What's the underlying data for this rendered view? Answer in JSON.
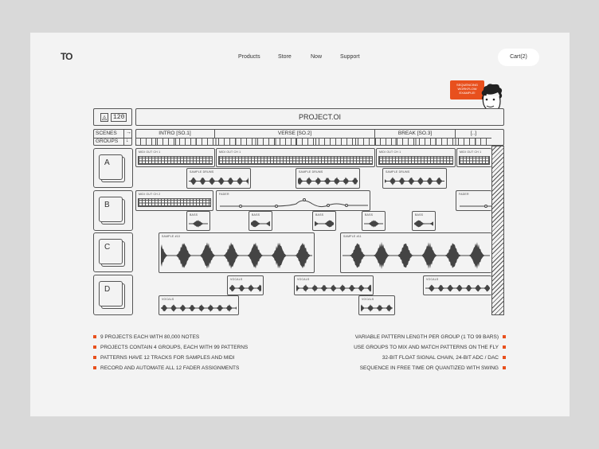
{
  "nav": {
    "logo": "TO",
    "items": [
      "Products",
      "Store",
      "Now",
      "Support"
    ],
    "cart": "Cart(2)"
  },
  "callout": "SEQUENCING WORKFLOW EXAMPLE!",
  "tempo": "120",
  "project_title": "PROJECT.OI",
  "row_labels": {
    "scenes": "SCENES",
    "groups": "GROUPS",
    "scenes_arrow": "→",
    "groups_arrow": "↓"
  },
  "scenes": [
    "INTRO [SO.1]",
    "VERSE [SO.2]",
    "BREAK [SO.3]",
    "[..]"
  ],
  "groups": [
    "A",
    "B",
    "C",
    "D"
  ],
  "clips": {
    "midi1": "MIDI OUT CH 1",
    "midi2": "MIDI OUT CH 2",
    "drums": "SAMPLE DRUMS",
    "fader": "FADER",
    "bass": "BASS",
    "s10": "SAMPLE #10",
    "s11": "SAMPLE #11",
    "vocals": "VOCALS"
  },
  "features_left": [
    "9 PROJECTS EACH WITH 80,000 NOTES",
    "PROJECTS CONTAIN 4 GROUPS, EACH WITH 99 PATTERNS",
    "PATTERNS HAVE 12 TRACKS FOR SAMPLES AND MIDI",
    "RECORD AND AUTOMATE ALL 12 FADER ASSIGNMENTS"
  ],
  "features_right": [
    "VARIABLE PATTERN LENGTH PER GROUP (1 TO 99 BARS)",
    "USE GROUPS TO MIX AND MATCH PATTERNS ON THE FLY",
    "32-BIT FLOAT SIGNAL CHAIN, 24-BIT ADC / DAC",
    "SEQUENCE IN FREE TIME OR QUANTIZED WITH SWING"
  ],
  "colors": {
    "accent": "#e8501d"
  }
}
